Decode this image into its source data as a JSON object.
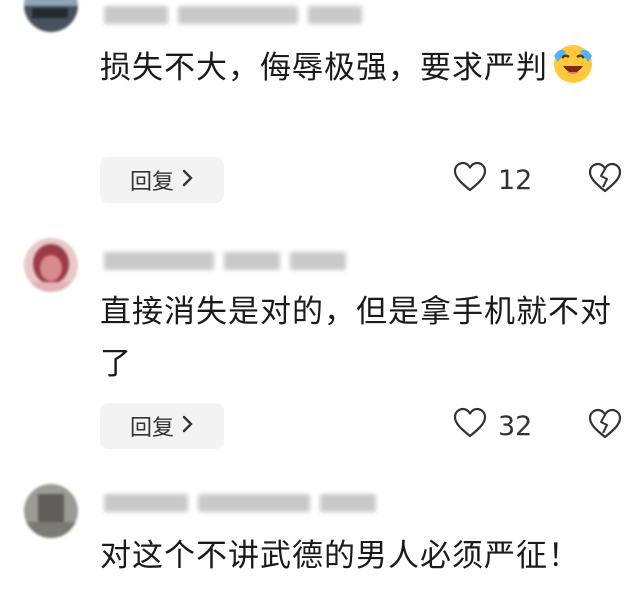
{
  "comments": [
    {
      "text": "损失不大，侮辱极强，要求严判",
      "emoji": "laughing-crying-emoji",
      "reply_label": "回复",
      "like_count": "12"
    },
    {
      "text": "直接消失是对的，但是拿手机就不对了",
      "reply_label": "回复",
      "like_count": "32"
    },
    {
      "text": "对这个不讲武德的男人必须严征！"
    }
  ],
  "icons": {
    "heart": "heart-outline-icon",
    "broken_heart": "broken-heart-icon",
    "chevron": "chevron-right-icon"
  },
  "colors": {
    "text": "#1a1a1a",
    "button_bg": "#f3f3f3",
    "icon": "#333333"
  }
}
